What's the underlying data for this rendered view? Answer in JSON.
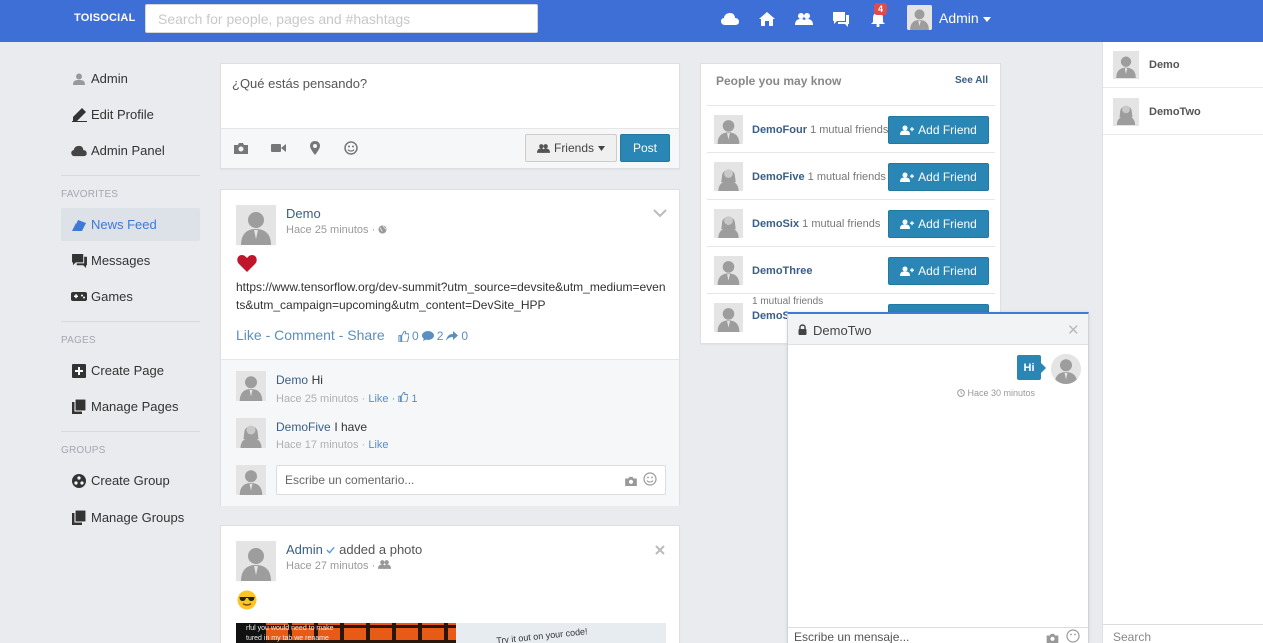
{
  "topbar": {
    "brand": "TOISOCIAL",
    "search_placeholder": "Search for people, pages and #hashtags",
    "notifications_count": "4",
    "user_name": "Admin"
  },
  "sidebar": {
    "items_top": [
      {
        "label": "Admin",
        "icon": "user-icon"
      },
      {
        "label": "Edit Profile",
        "icon": "pencil-icon"
      },
      {
        "label": "Admin Panel",
        "icon": "cloud-icon"
      }
    ],
    "favorites_heading": "FAVORITES",
    "favorites": [
      {
        "label": "News Feed",
        "icon": "news-feed-icon",
        "active": true
      },
      {
        "label": "Messages",
        "icon": "messages-icon"
      },
      {
        "label": "Games",
        "icon": "gamepad-icon"
      }
    ],
    "pages_heading": "PAGES",
    "pages": [
      {
        "label": "Create Page",
        "icon": "plus-square-icon"
      },
      {
        "label": "Manage Pages",
        "icon": "pages-icon"
      }
    ],
    "groups_heading": "GROUPS",
    "groups": [
      {
        "label": "Create Group",
        "icon": "group-circle-icon"
      },
      {
        "label": "Manage Groups",
        "icon": "pages-icon"
      }
    ]
  },
  "composer": {
    "placeholder": "¿Qué estás pensando?",
    "privacy_label": "Friends",
    "post_label": "Post"
  },
  "post1": {
    "author": "Demo",
    "time": "Hace 25 minutos ·",
    "link": "https://www.tensorflow.org/dev-summit?utm_source=devsite&utm_medium=events&utm_campaign=upcoming&utm_content=DevSite_HPP",
    "actions": {
      "like": "Like",
      "comment": "Comment",
      "share": "Share",
      "sep": " - "
    },
    "stats": {
      "likes": "0",
      "comments": "2",
      "shares": "0"
    },
    "comments": [
      {
        "author": "Demo",
        "text": "Hi",
        "time": "Hace 25 minutos ·",
        "like": "Like",
        "likes": "1"
      },
      {
        "author": "DemoFive",
        "text": "I have",
        "time": "Hace 17 minutos ·",
        "like": "Like"
      }
    ],
    "comment_placeholder": "Escribe un comentario..."
  },
  "post2": {
    "author": "Admin",
    "action": "added a photo",
    "time": "Hace 27 minutos ·",
    "photo_text": [
      "rful you would need to make",
      "tured in my tab we rename",
      "Try it out on your code!"
    ]
  },
  "pymk": {
    "title": "People you may know",
    "see_all": "See All",
    "people": [
      {
        "name": "DemoFour",
        "mutual": "1 mutual friends"
      },
      {
        "name": "DemoFive",
        "mutual": "1 mutual friends"
      },
      {
        "name": "DemoSix",
        "mutual": "1 mutual friends"
      },
      {
        "name": "DemoThree",
        "mutual": ""
      },
      {
        "name": "DemoS",
        "mutual": "1 mutual friends"
      }
    ],
    "add_label": "Add Friend"
  },
  "online": {
    "users": [
      "Demo",
      "DemoTwo"
    ],
    "search_placeholder": "Search"
  },
  "chat": {
    "title": "DemoTwo",
    "message": "Hi",
    "time": "Hace 30 minutos",
    "input_placeholder": "Escribe un mensaje..."
  },
  "colors": {
    "topbar": "#3d6fd6",
    "primary_button": "#2a86b4",
    "link": "#3a5e86",
    "badge": "#e04b4b"
  }
}
